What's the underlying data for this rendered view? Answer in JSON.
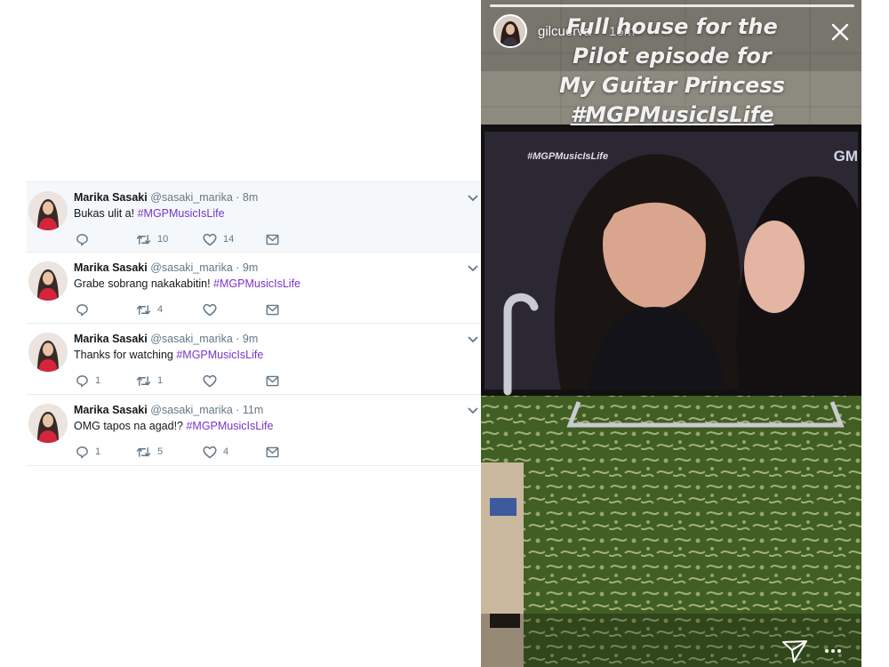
{
  "tweets": [
    {
      "name": "Marika Sasaki",
      "handle": "@sasaki_marika",
      "dot": "·",
      "time": "8m",
      "text": "Bukas ulit a! ",
      "hashtag": "#MGPMusicIsLife",
      "replies": "",
      "retweets": "10",
      "likes": "14"
    },
    {
      "name": "Marika Sasaki",
      "handle": "@sasaki_marika",
      "dot": "·",
      "time": "9m",
      "text": "Grabe sobrang nakakabitin! ",
      "hashtag": "#MGPMusicIsLife",
      "replies": "",
      "retweets": "4",
      "likes": ""
    },
    {
      "name": "Marika Sasaki",
      "handle": "@sasaki_marika",
      "dot": "·",
      "time": "9m",
      "text": "Thanks for watching ",
      "hashtag": "#MGPMusicIsLife",
      "replies": "1",
      "retweets": "1",
      "likes": ""
    },
    {
      "name": "Marika Sasaki",
      "handle": "@sasaki_marika",
      "dot": "·",
      "time": "11m",
      "text": "OMG tapos na agad!? ",
      "hashtag": "#MGPMusicIsLife",
      "replies": "1",
      "retweets": "5",
      "likes": "4"
    }
  ],
  "story": {
    "username": "gilcuerva",
    "time": "15m",
    "caption": [
      "Full house for the",
      "Pilot episode for",
      "My Guitar Princess",
      "#MGPMusicIsLife"
    ],
    "tv_overlay": "#MGPMusicIsLife",
    "tv_logo": "GM"
  },
  "icons": {
    "reply": "reply-icon",
    "retweet": "retweet-icon",
    "like": "heart-icon",
    "dm": "envelope-icon",
    "caret": "chevron-down-icon",
    "close": "close-icon",
    "send": "send-icon",
    "more": "more-icon"
  },
  "colors": {
    "hashtag": "#7a35c9",
    "muted": "#657786",
    "divider": "#e6ecf0"
  }
}
